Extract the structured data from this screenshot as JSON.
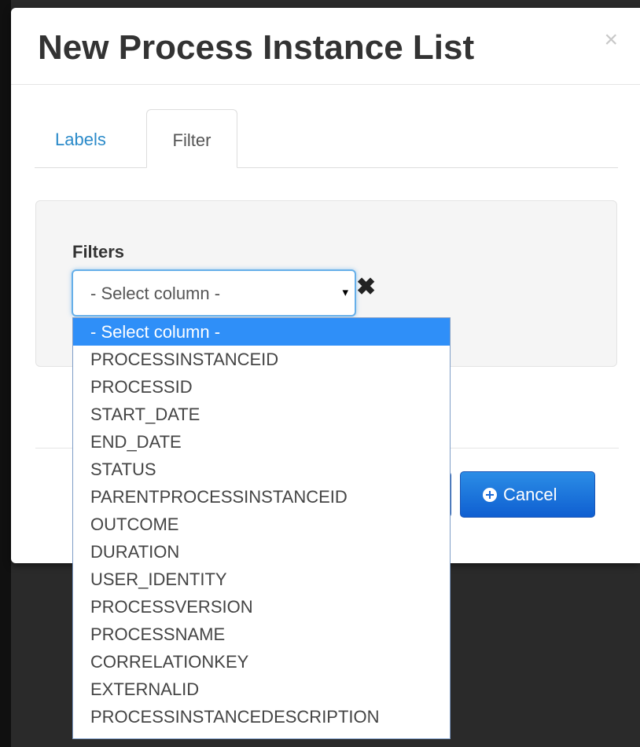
{
  "modal": {
    "title": "New Process Instance List",
    "close_icon": "close-icon"
  },
  "tabs": [
    {
      "label": "Labels",
      "active": false
    },
    {
      "label": "Filter",
      "active": true
    }
  ],
  "filters": {
    "label": "Filters",
    "select_value": "- Select column -",
    "dropdown_arrow": "▾",
    "remove_icon": "remove-icon",
    "options": [
      "- Select column -",
      "PROCESSINSTANCEID",
      "PROCESSID",
      "START_DATE",
      "END_DATE",
      "STATUS",
      "PARENTPROCESSINSTANCEID",
      "OUTCOME",
      "DURATION",
      "USER_IDENTITY",
      "PROCESSVERSION",
      "PROCESSNAME",
      "CORRELATIONKEY",
      "EXTERNALID",
      "PROCESSINSTANCEDESCRIPTION"
    ],
    "selected_index": 0
  },
  "footer": {
    "cancel_label": "Cancel"
  },
  "colors": {
    "accent": "#2a8ac9",
    "button_primary": "#1a6ad8",
    "selected_option": "#2f8ff8"
  }
}
